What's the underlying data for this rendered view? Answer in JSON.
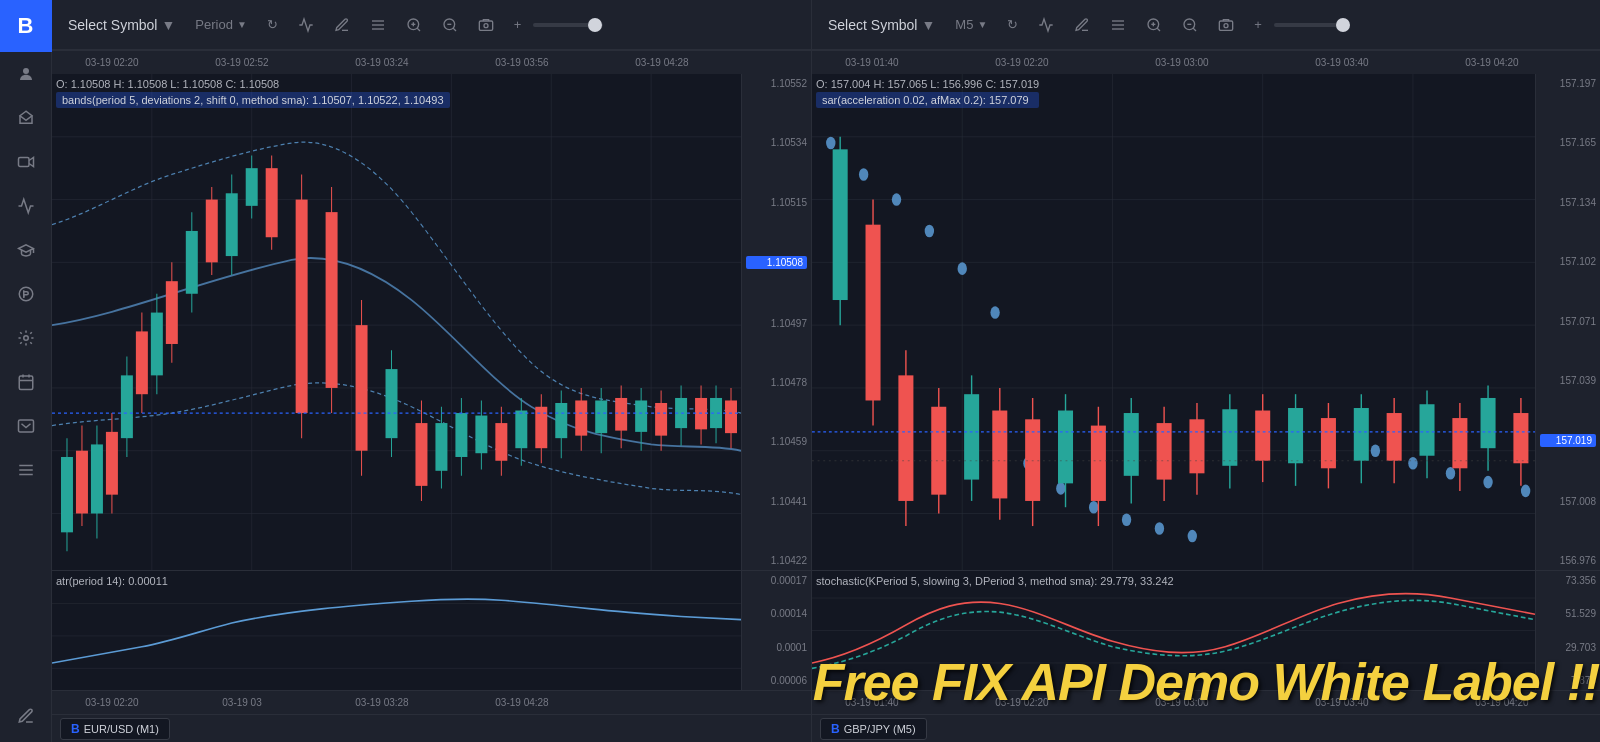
{
  "sidebar": {
    "logo": "B",
    "items": [
      {
        "name": "user-icon",
        "symbol": "👤"
      },
      {
        "name": "balance-icon",
        "symbol": "⚖"
      },
      {
        "name": "video-icon",
        "symbol": "🎥"
      },
      {
        "name": "chart-icon",
        "symbol": "📈"
      },
      {
        "name": "graduation-icon",
        "symbol": "🎓"
      },
      {
        "name": "mask-icon",
        "symbol": "🎭"
      },
      {
        "name": "wrench-icon",
        "symbol": "🔧"
      },
      {
        "name": "calendar-icon",
        "symbol": "📅"
      },
      {
        "name": "table-icon",
        "symbol": "📊"
      },
      {
        "name": "list-icon",
        "symbol": "☰"
      },
      {
        "name": "pen-icon",
        "symbol": "✏"
      }
    ]
  },
  "chart_left": {
    "symbol": "Select Symbol",
    "period": "Period",
    "ohlc": "O: 1.10508  H: 1.10508  L: 1.10508  C: 1.10508",
    "indicator": "bands(period 5, deviations 2, shift 0, method sma): 1.10507, 1.10522, 1.10493",
    "sub_indicator": "atr(period 14): 0.00011",
    "prices": [
      "1.10552",
      "1.10534",
      "1.10515",
      "1.10508",
      "1.10497",
      "1.10478",
      "1.10459",
      "1.10441",
      "1.10422"
    ],
    "sub_prices": [
      "0.00017",
      "0.00014",
      "0.0001",
      "0.00006"
    ],
    "times": [
      "03-19 02:20",
      "03-19 02:52",
      "03-19 03:24",
      "03-19 03:56",
      "03-19 04:28"
    ],
    "tab_label": "EUR/USD (M1)",
    "current_price": "1.10508"
  },
  "chart_right": {
    "symbol": "Select Symbol",
    "period": "M5",
    "ohlc": "O: 157.004  H: 157.065  L: 156.996  C: 157.019",
    "indicator": "sar(acceleration 0.02, afMax 0.2): 157.079",
    "sub_indicator": "stochastic(KPeriod 5, slowing 3, DPeriod 3, method sma): 29.779, 33.242",
    "prices": [
      "157.197",
      "157.165",
      "157.134",
      "157.102",
      "157.071",
      "157.039",
      "157.008",
      "156.976"
    ],
    "sub_prices": [
      "73.356",
      "51.529",
      "29.703",
      "7.876"
    ],
    "times": [
      "03-19 01:40",
      "03-19 02:20",
      "03-19 03:00",
      "03-19 03:40",
      "03-19 04:20"
    ],
    "tab_label": "GBP/JPY (M5)",
    "current_price": "157.019",
    "current_price2": "157.008"
  },
  "watermark": "Free FIX API Demo White Label !!",
  "toolbar": {
    "refresh_label": "↻",
    "line_chart_label": "📈",
    "draw_label": "✏",
    "indicators_label": "≡",
    "zoom_in_label": "🔍",
    "zoom_out_label": "🔍",
    "screenshot_label": "📷",
    "add_label": "+"
  }
}
